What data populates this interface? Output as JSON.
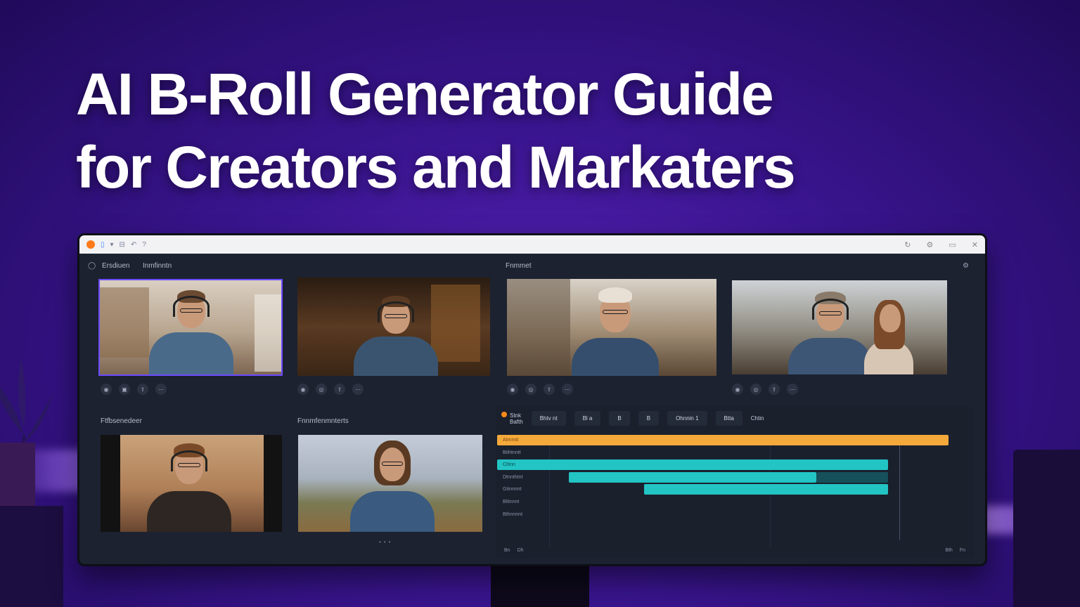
{
  "headline": {
    "line1": "AI B-Roll Generator Guide",
    "line2": "for Creators and Markaters"
  },
  "colors": {
    "background": "#3a1590",
    "accent_orange": "#f5a93b",
    "accent_teal": "#22c4c4",
    "selection": "#6b4bff"
  },
  "app": {
    "panels": {
      "left_tab_1": "Ersdiuen",
      "left_tab_2": "Inmfinntn",
      "right_header": "Fnmmet",
      "lower_left_label": "Ftfbsenedeer",
      "lower_mid_label": "Fnnmfenmnterts"
    },
    "timeline": {
      "header_tag": "Stnk",
      "header_sub": "Bafth",
      "buttons": [
        "Bhtv nt",
        "Bl a",
        "B",
        "B",
        "Ohnnin 1",
        "Btta"
      ],
      "extra_label": "Chtin",
      "tracks": [
        {
          "label": "Atmmtt"
        },
        {
          "label": "Btihtnntt"
        },
        {
          "label": "Cltinn"
        },
        {
          "label": "Dtnnthtnt"
        },
        {
          "label": "Gtinnnnt"
        },
        {
          "label": "Bltinnnt"
        },
        {
          "label": "Bthnnnnt"
        }
      ],
      "footer": [
        "Bn",
        "Dh",
        "Bth",
        "Fn"
      ]
    }
  }
}
